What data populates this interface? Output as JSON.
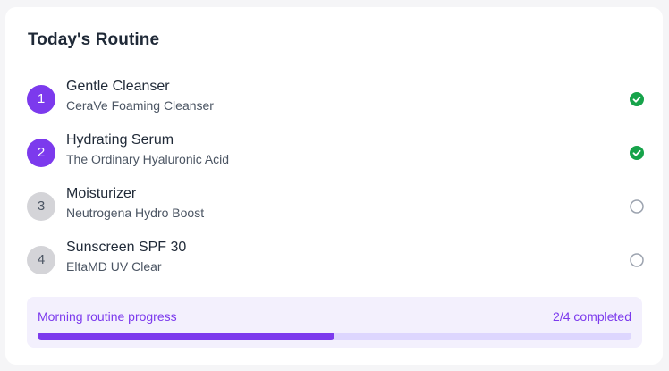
{
  "routine": {
    "title": "Today's Routine",
    "steps": [
      {
        "number": "1",
        "name": "Gentle Cleanser",
        "product": "CeraVe Foaming Cleanser",
        "completed": true
      },
      {
        "number": "2",
        "name": "Hydrating Serum",
        "product": "The Ordinary Hyaluronic Acid",
        "completed": true
      },
      {
        "number": "3",
        "name": "Moisturizer",
        "product": "Neutrogena Hydro Boost",
        "completed": false
      },
      {
        "number": "4",
        "name": "Sunscreen SPF 30",
        "product": "EltaMD UV Clear",
        "completed": false
      }
    ]
  },
  "progress": {
    "label": "Morning routine progress",
    "count_text": "2/4 completed",
    "fraction": 0.5
  },
  "colors": {
    "accent": "#7c3aed",
    "done_check": "#16a34a",
    "pending_circle": "#9ca3af"
  },
  "icons": {
    "completed": "check-circle-icon",
    "pending": "empty-circle-icon"
  }
}
